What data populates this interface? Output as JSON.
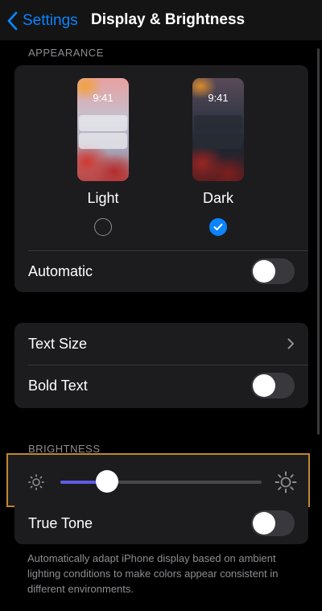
{
  "nav": {
    "back_label": "Settings",
    "title": "Display & Brightness"
  },
  "appearance": {
    "header": "APPEARANCE",
    "options": [
      {
        "label": "Light",
        "time": "9:41",
        "selected": false
      },
      {
        "label": "Dark",
        "time": "9:41",
        "selected": true
      }
    ],
    "automatic": {
      "label": "Automatic",
      "on": false
    }
  },
  "text": {
    "text_size_label": "Text Size",
    "bold_text": {
      "label": "Bold Text",
      "on": false
    }
  },
  "brightness": {
    "header": "BRIGHTNESS",
    "level_fraction": 0.23,
    "true_tone": {
      "label": "True Tone",
      "on": false
    },
    "footer": "Automatically adapt iPhone display based on ambient lighting conditions to make colors appear consistent in different environments."
  },
  "colors": {
    "accent": "#0a84ff",
    "slider_fill": "#5e5ce6",
    "highlight_border": "#c0872e"
  }
}
